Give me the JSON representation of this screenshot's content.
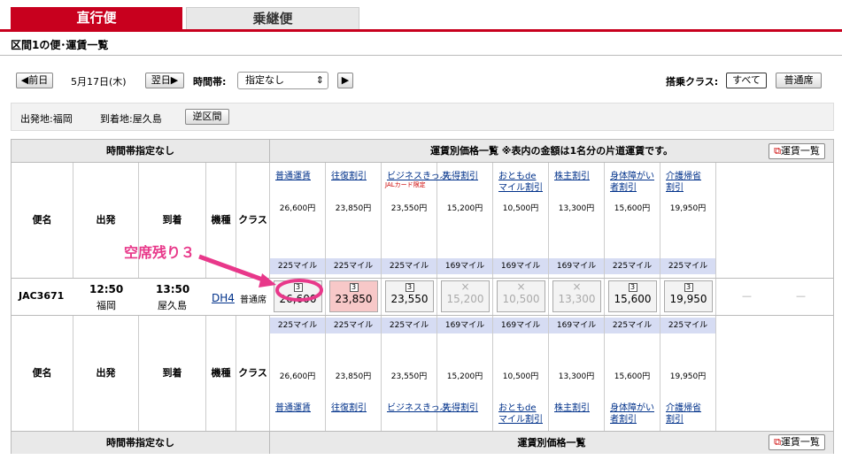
{
  "tabs": {
    "direct": "直行便",
    "connecting": "乗継便"
  },
  "section_title": "区間1の便･運賃一覧",
  "controls": {
    "prev": "◀前日",
    "date": "5月17日(木)",
    "next": "翌日▶",
    "time_label": "時間帯:",
    "time_value": "指定なし",
    "go": "▶",
    "class_label": "搭乗クラス:",
    "class_all": "すべて",
    "class_economy": "普通席"
  },
  "route": {
    "from": "出発地:福岡",
    "to": "到着地:屋久島",
    "reverse": "逆区間"
  },
  "table": {
    "time_note": "時間帯指定なし",
    "fare_title": "運賃別価格一覧 ※表内の金額は1名分の片道運賃です。",
    "fare_title2": "運賃別価格一覧",
    "fare_list_btn": "運賃一覧",
    "col_flight": "便名",
    "col_dep": "出発",
    "col_arr": "到着",
    "col_type": "機種",
    "col_class": "クラス",
    "fares": [
      {
        "l1": "普通運賃",
        "l2": "",
        "note": "",
        "price": "26,600円",
        "mile": "225マイル",
        "seat": "3",
        "now": "26,600",
        "avail": true
      },
      {
        "l1": "往復割引",
        "l2": "",
        "note": "",
        "price": "23,850円",
        "mile": "225マイル",
        "seat": "3",
        "now": "23,850",
        "avail": true,
        "pink": true
      },
      {
        "l1": "ビジネスきっぷ",
        "l2": "",
        "note": "JALカード限定",
        "price": "23,550円",
        "mile": "225マイル",
        "seat": "3",
        "now": "23,550",
        "avail": true
      },
      {
        "l1": "先得割引",
        "l2": "",
        "note": "",
        "price": "15,200円",
        "mile": "169マイル",
        "seat": "×",
        "now": "15,200",
        "avail": false
      },
      {
        "l1": "おともde",
        "l2": "マイル割引",
        "note": "",
        "price": "10,500円",
        "mile": "169マイル",
        "seat": "×",
        "now": "10,500",
        "avail": false
      },
      {
        "l1": "株主割引",
        "l2": "",
        "note": "",
        "price": "13,300円",
        "mile": "169マイル",
        "seat": "×",
        "now": "13,300",
        "avail": false
      },
      {
        "l1": "身体障がい",
        "l2": "者割引",
        "note": "",
        "price": "15,600円",
        "mile": "225マイル",
        "seat": "3",
        "now": "15,600",
        "avail": true
      },
      {
        "l1": "介護帰省",
        "l2": "割引",
        "note": "",
        "price": "19,950円",
        "mile": "225マイル",
        "seat": "3",
        "now": "19,950",
        "avail": true
      }
    ],
    "flight": {
      "no": "JAC3671",
      "dep_time": "12:50",
      "dep_city": "福岡",
      "arr_time": "13:50",
      "arr_city": "屋久島",
      "type": "DH4",
      "class": "普通席"
    },
    "dash": "—"
  },
  "callout": "空席残り３"
}
